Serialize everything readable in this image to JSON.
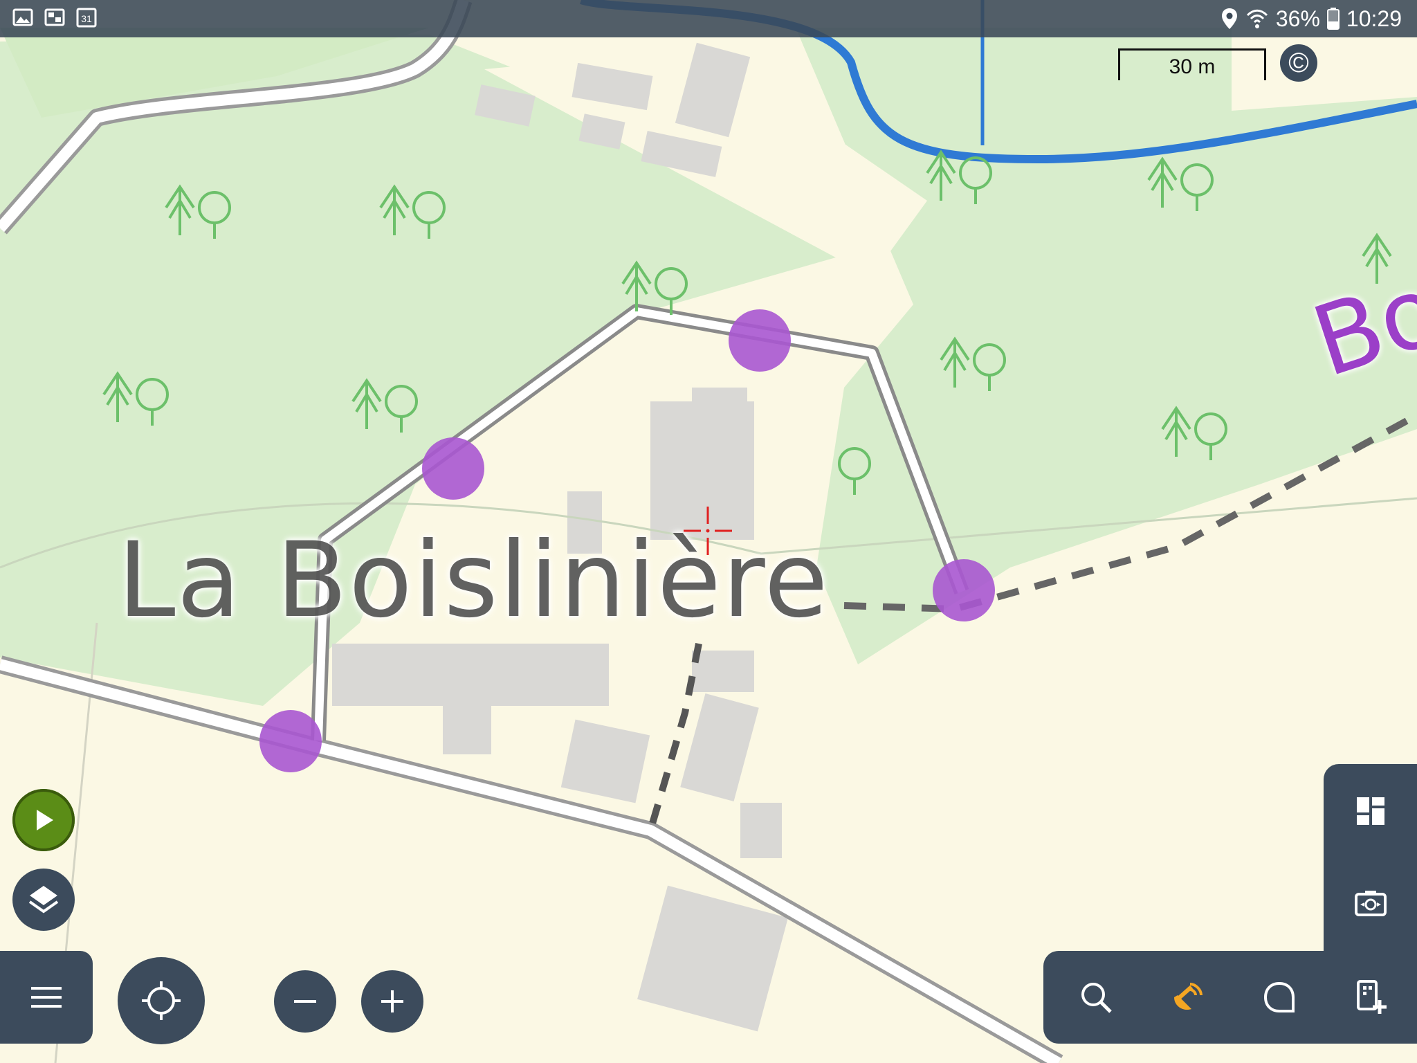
{
  "statusbar": {
    "battery": "36%",
    "time": "10:29",
    "left_icons": [
      "gallery-icon",
      "gallery-icon",
      "calendar-icon"
    ],
    "calendar_day": "31"
  },
  "map": {
    "scale_label": "30 m",
    "copyright_symbol": "©",
    "place_label": "La Boislinière",
    "partial_label": "Bo",
    "colors": {
      "woodland": "#d8edcc",
      "land": "#fbf8e4",
      "building": "#d9d8d5",
      "river": "#2f7ad4",
      "route_point": "#a857d0",
      "path_dash": "#666666",
      "tree_symbol": "#6cc06a"
    }
  },
  "controls": {
    "play_icon": "play-icon",
    "layers_icon": "layers-icon",
    "menu_icon": "menu-icon",
    "locate_icon": "crosshair-icon",
    "zoom_out_icon": "minus-icon",
    "zoom_in_icon": "plus-icon",
    "toolbar_icons": [
      "search-icon",
      "gps-satellite-icon",
      "chat-bubble-icon",
      "add-point-icon"
    ],
    "side_icons": [
      "dashboard-icon",
      "camera-switch-icon"
    ],
    "panel_color": "#3c4b5c",
    "play_color": "#5b8d17",
    "gps_color": "#f5a623"
  }
}
